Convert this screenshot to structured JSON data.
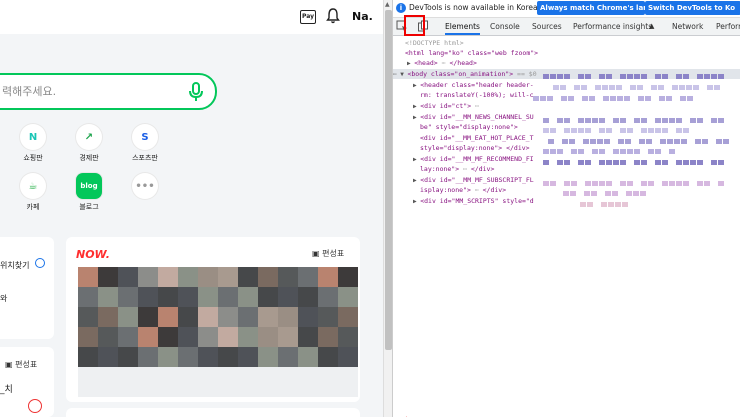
{
  "left": {
    "topbar": {
      "pay_label": "Pay",
      "avatar_label": "Na."
    },
    "search": {
      "placeholder": "력해주세요."
    },
    "services": [
      {
        "label": "쇼핑판",
        "color": "#19c5b5",
        "glyph": "N"
      },
      {
        "label": "경제판",
        "color": "#1aa34a",
        "glyph": "↗"
      },
      {
        "label": "스포츠판",
        "color": "#1a5ee6",
        "glyph": "S"
      },
      {
        "label": "카페",
        "color": "#2bb24c",
        "glyph": "☕"
      },
      {
        "label": "블로그",
        "color": "#03c75a",
        "glyph": "blog"
      },
      {
        "label": "",
        "color": "#999999",
        "glyph": "•••"
      }
    ],
    "card1": {
      "label1": "위치찾기",
      "label2": "와"
    },
    "now_card": {
      "brand": "NOW.",
      "edit_label": "편성표"
    },
    "card2": {
      "edit_label": "편성표",
      "label": "_치"
    }
  },
  "devtools": {
    "info_message": "DevTools is now available in Korean!",
    "btn_match": "Always match Chrome's language",
    "btn_switch": "Switch DevTools to Ko",
    "tabs": [
      "Elements",
      "Console",
      "Sources",
      "Performance insights",
      "Network",
      "Perform"
    ],
    "code": {
      "doctype": "<!DOCTYPE html>",
      "html_open": "<html lang=\"ko\" class=\"web fzoom\">",
      "head": "<head>",
      "head_close": "</head>",
      "body": "<body class=\"on_animation\">",
      "body_eq": "== $0",
      "header": "<header class=\"header header-",
      "header2": "rm: translateY(-100%); will-c",
      "ct": "<div id=\"ct\">",
      "news1": "<div id=\"__MM_NEWS_CHANNEL_SU",
      "news2": "be\" style=\"display:none\">",
      "eat1": "<div id=\"__MM_EAT_HOT_PLACE_T",
      "eat2": "style=\"display:none\"> </div>",
      "rec1": "<div id=\"__MM_MF_RECOMMEND_FI",
      "rec2": "lay:none\">",
      "rec2_end": "</div>",
      "sub1": "<div id=\"__MM_MF_SUBSCRIPT_FL",
      "sub2": "isplay:none\">",
      "sub2_end": "</div>",
      "scripts": "<div id=\"MM_SCRIPTS\" style=\"d"
    }
  },
  "colors": {
    "accent": "#03c75a",
    "devtools_blue": "#1a73e8",
    "highlight": "#e00000"
  }
}
